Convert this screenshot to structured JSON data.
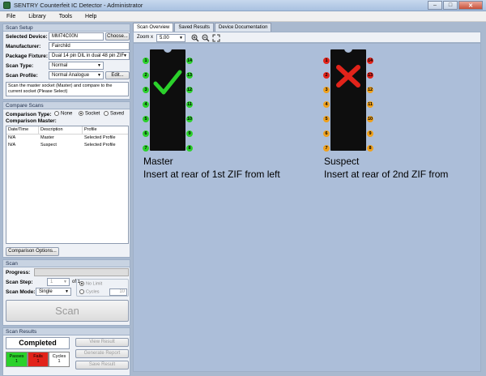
{
  "window": {
    "title": "SENTRY Counterfeit IC Detector - Administrator"
  },
  "menu": [
    "File",
    "Library",
    "Tools",
    "Help"
  ],
  "scan_setup": {
    "header": "Scan Setup",
    "selected_device_label": "Selected Device:",
    "selected_device_value": "MM74C00N",
    "choose_button": "Choose...",
    "manufacturer_label": "Manufacturer:",
    "manufacturer_value": "Fairchild",
    "package_label": "Package Fixture:",
    "package_value": "Dual 14 pin DIL in dual 48 pin ZIF",
    "scan_type_label": "Scan Type:",
    "scan_type_value": "Normal",
    "scan_profile_label": "Scan Profile:",
    "scan_profile_value": "Normal Analogue",
    "edit_button": "Edit...",
    "help_text": "Scan the master socket (Master) and compare to the current socket (Please Select)"
  },
  "compare_scans": {
    "header": "Compare Scans",
    "comparison_type_label": "Comparison Type:",
    "options": [
      "None",
      "Socket",
      "Saved"
    ],
    "selected_option": "Socket",
    "comparison_master_label": "Comparison Master:",
    "columns": [
      "Date/Time",
      "Description",
      "Profile"
    ],
    "rows": [
      [
        "N/A",
        "Master",
        "Selected Profile"
      ],
      [
        "N/A",
        "Suspect",
        "Selected Profile"
      ]
    ],
    "options_button": "Comparison Options..."
  },
  "scan": {
    "header": "Scan",
    "progress_label": "Progress:",
    "scan_step_label": "Scan Step:",
    "scan_step_value": "1",
    "scan_step_of": "of 1",
    "scan_mode_label": "Scan Mode:",
    "scan_mode_value": "Single",
    "no_limit_label": "No Limit",
    "cycles_label": "Cycles",
    "cycles_value": "10",
    "scan_button": "Scan"
  },
  "scan_results": {
    "header": "Scan Results",
    "status": "Completed",
    "view_result": "View Result",
    "generate_report": "Generate Report",
    "save_result": "Save Result",
    "passes_label": "Passes",
    "passes_value": "1",
    "fails_label": "Fails",
    "fails_value": "1",
    "cycles_label": "Cycles",
    "cycles_value": "1"
  },
  "tabs": [
    "Scan Overview",
    "Saved Results",
    "Device Documentation"
  ],
  "toolbar": {
    "zoom_label": "Zoom x",
    "zoom_value": "5.00"
  },
  "chips": [
    {
      "id": "master",
      "caption_title": "Master",
      "caption_sub": "Insert at rear of 1st ZIF from left",
      "result": "pass",
      "left_pins": [
        "1",
        "2",
        "3",
        "4",
        "5",
        "6",
        "7"
      ],
      "right_pins": [
        "14",
        "13",
        "12",
        "11",
        "10",
        "9",
        "8"
      ],
      "left_colors": [
        "#2bd12b",
        "#2bd12b",
        "#2bd12b",
        "#2bd12b",
        "#2bd12b",
        "#2bd12b",
        "#2bd12b"
      ],
      "right_colors": [
        "#2bd12b",
        "#2bd12b",
        "#2bd12b",
        "#2bd12b",
        "#2bd12b",
        "#2bd12b",
        "#2bd12b"
      ]
    },
    {
      "id": "suspect",
      "caption_title": "Suspect",
      "caption_sub": "Insert at rear of 2nd ZIF from",
      "result": "fail",
      "left_pins": [
        "1",
        "2",
        "3",
        "4",
        "5",
        "6",
        "7"
      ],
      "right_pins": [
        "14",
        "13",
        "12",
        "11",
        "10",
        "9",
        "8"
      ],
      "left_colors": [
        "#e2231a",
        "#e2231a",
        "#f0a11c",
        "#f0a11c",
        "#f0a11c",
        "#f0a11c",
        "#f0a11c"
      ],
      "right_colors": [
        "#e2231a",
        "#e2231a",
        "#f0a11c",
        "#f0a11c",
        "#f0a11c",
        "#f0a11c",
        "#f0a11c"
      ]
    }
  ],
  "colors": {
    "pass": "#2bd12b",
    "fail": "#e2231a",
    "warn": "#f0a11c"
  }
}
